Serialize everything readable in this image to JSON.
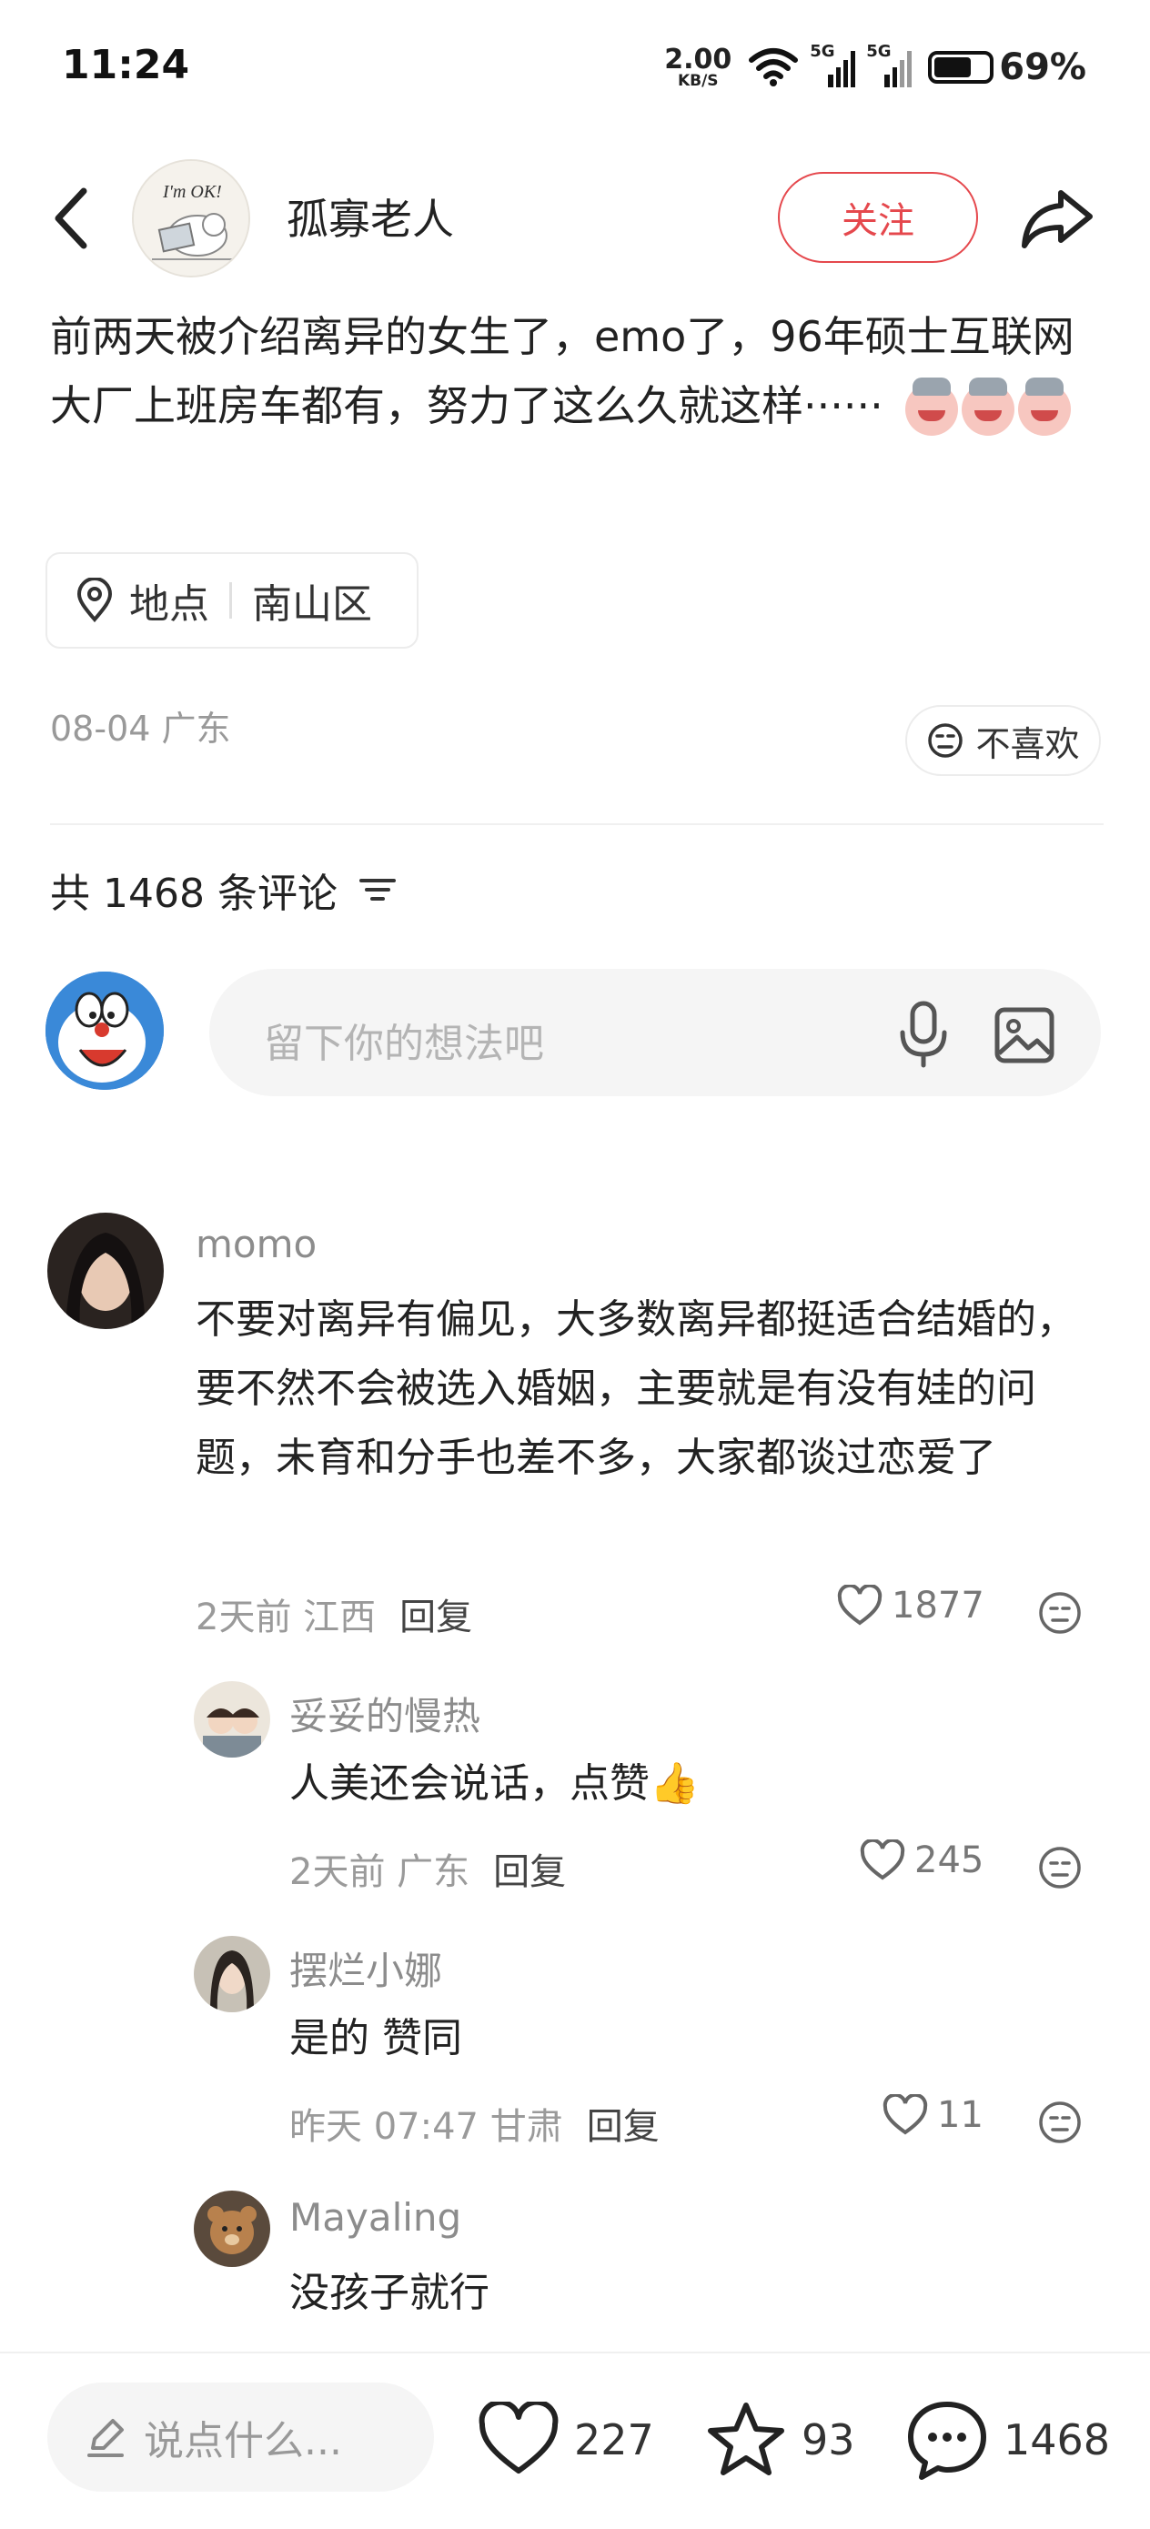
{
  "status_bar": {
    "time": "11:24",
    "net_speed_value": "2.00",
    "net_speed_unit": "KB/S",
    "signal_1_label": "5G",
    "signal_2_label": "5G",
    "battery": "69%",
    "battery_level": 0.69
  },
  "header": {
    "author_name": "孤寡老人",
    "follow_label": "关注",
    "avatar_text": "I'm OK!"
  },
  "post": {
    "text": "前两天被介绍离异的女生了，emo了，96年硕士互联网大厂上班房车都有，努力了这么久就这样······",
    "emoji_count": 3,
    "location_label": "地点",
    "location_value": "南山区",
    "date": "08-04 广东",
    "dislike_label": "不喜欢"
  },
  "comments_section": {
    "count_label": "共 1468 条评论",
    "input_placeholder": "留下你的想法吧"
  },
  "comments": [
    {
      "name": "momo",
      "text": "不要对离异有偏见，大多数离异都挺适合结婚的，要不然不会被选入婚姻，主要就是有没有娃的问题，未育和分手也差不多，大家都谈过恋爱了",
      "meta": "2天前 江西",
      "reply": "回复",
      "likes": "1877"
    },
    {
      "name": "妥妥的慢热",
      "text": "人美还会说话，点赞👍",
      "meta": "2天前 广东",
      "reply": "回复",
      "likes": "245"
    },
    {
      "name": "摆烂小娜",
      "text": "是的 赞同",
      "meta": "昨天 07:47 甘肃",
      "reply": "回复",
      "likes": "11"
    },
    {
      "name": "Mayaling",
      "text": "没孩子就行"
    }
  ],
  "bottom_bar": {
    "say_placeholder": "说点什么...",
    "likes": "227",
    "stars": "93",
    "comments": "1468"
  },
  "colors": {
    "accent": "#e5484d",
    "muted": "#999999"
  }
}
